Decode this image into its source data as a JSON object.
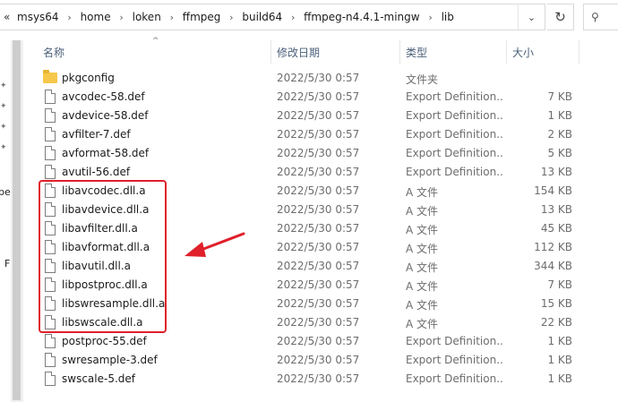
{
  "address_bar": {
    "overflow_glyph": "«",
    "separator": "›",
    "crumbs": [
      "msys64",
      "home",
      "loken",
      "ffmpeg",
      "build64",
      "ffmpeg-n4.4.1-mingw",
      "lib"
    ],
    "dropdown_glyph": "⌄",
    "refresh_glyph": "↻",
    "search_glyph": "⚲"
  },
  "nav_pane": {
    "fragments": [
      "be",
      "F"
    ]
  },
  "columns": {
    "name": "名称",
    "date": "修改日期",
    "type": "类型",
    "size": "大小",
    "sort_glyph": "^"
  },
  "files": [
    {
      "name": "pkgconfig",
      "date": "2022/5/30 0:57",
      "type": "文件夹",
      "size": "",
      "kind": "folder"
    },
    {
      "name": "avcodec-58.def",
      "date": "2022/5/30 0:57",
      "type": "Export Definition...",
      "size": "7 KB",
      "kind": "file"
    },
    {
      "name": "avdevice-58.def",
      "date": "2022/5/30 0:57",
      "type": "Export Definition...",
      "size": "1 KB",
      "kind": "file"
    },
    {
      "name": "avfilter-7.def",
      "date": "2022/5/30 0:57",
      "type": "Export Definition...",
      "size": "2 KB",
      "kind": "file"
    },
    {
      "name": "avformat-58.def",
      "date": "2022/5/30 0:57",
      "type": "Export Definition...",
      "size": "5 KB",
      "kind": "file"
    },
    {
      "name": "avutil-56.def",
      "date": "2022/5/30 0:57",
      "type": "Export Definition...",
      "size": "13 KB",
      "kind": "file"
    },
    {
      "name": "libavcodec.dll.a",
      "date": "2022/5/30 0:57",
      "type": "A 文件",
      "size": "154 KB",
      "kind": "file"
    },
    {
      "name": "libavdevice.dll.a",
      "date": "2022/5/30 0:57",
      "type": "A 文件",
      "size": "13 KB",
      "kind": "file"
    },
    {
      "name": "libavfilter.dll.a",
      "date": "2022/5/30 0:57",
      "type": "A 文件",
      "size": "45 KB",
      "kind": "file"
    },
    {
      "name": "libavformat.dll.a",
      "date": "2022/5/30 0:57",
      "type": "A 文件",
      "size": "112 KB",
      "kind": "file"
    },
    {
      "name": "libavutil.dll.a",
      "date": "2022/5/30 0:57",
      "type": "A 文件",
      "size": "344 KB",
      "kind": "file"
    },
    {
      "name": "libpostproc.dll.a",
      "date": "2022/5/30 0:57",
      "type": "A 文件",
      "size": "7 KB",
      "kind": "file"
    },
    {
      "name": "libswresample.dll.a",
      "date": "2022/5/30 0:57",
      "type": "A 文件",
      "size": "15 KB",
      "kind": "file"
    },
    {
      "name": "libswscale.dll.a",
      "date": "2022/5/30 0:57",
      "type": "A 文件",
      "size": "22 KB",
      "kind": "file"
    },
    {
      "name": "postproc-55.def",
      "date": "2022/5/30 0:57",
      "type": "Export Definition...",
      "size": "1 KB",
      "kind": "file"
    },
    {
      "name": "swresample-3.def",
      "date": "2022/5/30 0:57",
      "type": "Export Definition...",
      "size": "1 KB",
      "kind": "file"
    },
    {
      "name": "swscale-5.def",
      "date": "2022/5/30 0:57",
      "type": "Export Definition...",
      "size": "1 KB",
      "kind": "file"
    }
  ],
  "annotation": {
    "color": "#e0202a"
  }
}
